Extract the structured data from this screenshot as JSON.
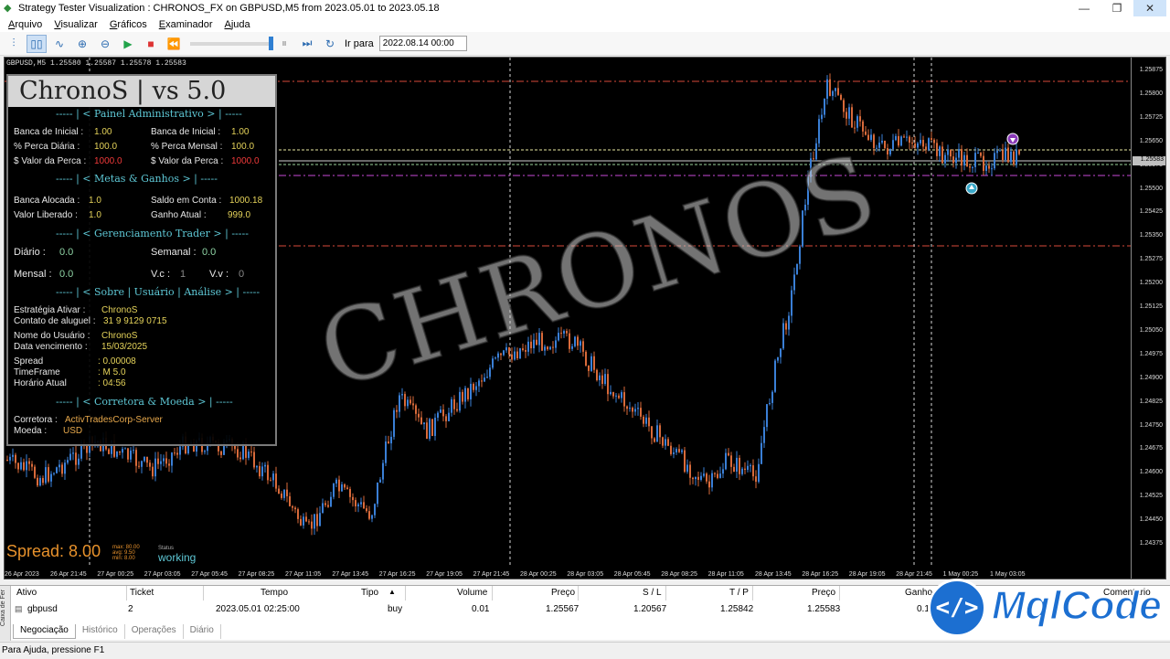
{
  "window": {
    "title": "Strategy Tester Visualization : CHRONOS_FX on GBPUSD,M5 from 2023.05.01 to 2023.05.18",
    "minimize": "—",
    "restore": "❐",
    "close": "✕"
  },
  "menu": [
    "Arquivo",
    "Visualizar",
    "Gráficos",
    "Examinador",
    "Ajuda"
  ],
  "toolbar": {
    "goto_label": "Ir para",
    "goto_date": "2022.08.14 00:00"
  },
  "chart": {
    "symbol_info": "GBPUSD,M5  1.25580 1.25587 1.25578 1.25583",
    "watermark": "CHRONOS",
    "current_price": "1.25583",
    "price_labels": [
      "1.25875",
      "1.25800",
      "1.25725",
      "1.25650",
      "1.25575",
      "1.25500",
      "1.25425",
      "1.25350",
      "1.25275",
      "1.25200",
      "1.25125",
      "1.25050",
      "1.24975",
      "1.24900",
      "1.24825",
      "1.24750",
      "1.24675",
      "1.24600",
      "1.24525",
      "1.24450",
      "1.24375"
    ],
    "time_labels": [
      "26 Apr 2023",
      "26 Apr 21:45",
      "27 Apr 00:25",
      "27 Apr 03:05",
      "27 Apr 05:45",
      "27 Apr 08:25",
      "27 Apr 11:05",
      "27 Apr 13:45",
      "27 Apr 16:25",
      "27 Apr 19:05",
      "27 Apr 21:45",
      "28 Apr 00:25",
      "28 Apr 03:05",
      "28 Apr 05:45",
      "28 Apr 08:25",
      "28 Apr 11:05",
      "28 Apr 13:45",
      "28 Apr 16:25",
      "28 Apr 19:05",
      "28 Apr 21:45",
      "1 May 00:25",
      "1 May 03:05"
    ],
    "spread_label": "Spread: 8.00",
    "spread_max": "max: 80.00",
    "spread_avg": "avg:  9.50",
    "spread_min": "min:  8.00",
    "status_label": "Status",
    "status_value": "working"
  },
  "panel": {
    "title": "ChronoS | vs 5.0",
    "section1": "----- | <   Painel Administrativo   > | -----",
    "banca_inicial_l": "Banca de Inicial  :",
    "banca_inicial_v": "1.00",
    "banca_inicial_r_l": "Banca de Inicial  :",
    "banca_inicial_r_v": "1.00",
    "perca_diaria_l": "% Perca Diária   :",
    "perca_diaria_v": "100.0",
    "perca_mensal_l": "% Perca Mensal  :",
    "perca_mensal_v": "100.0",
    "valor_perca_l": "$ Valor da Perca :",
    "valor_perca_v": "1000.0",
    "valor_perca_r_l": "$ Valor da Perca :",
    "valor_perca_r_v": "1000.0",
    "section2": "----- | <     Metas & Ganhos      > | -----",
    "banca_alocada_l": "Banca Alocada   :",
    "banca_alocada_v": "1.0",
    "saldo_conta_l": "Saldo em Conta  :",
    "saldo_conta_v": "1000.18",
    "valor_liberado_l": "Valor Liberado   :",
    "valor_liberado_v": "1.0",
    "ganho_atual_l": "Ganho Atual       :",
    "ganho_atual_v": "999.0",
    "section3": "----- | < Gerenciamento Trader > | -----",
    "diario_l": "Diário   :",
    "diario_v": "0.0",
    "semanal_l": "Semanal  :",
    "semanal_v": "0.0",
    "mensal_l": "Mensal  :",
    "mensal_v": "0.0",
    "vc_l": "V.c  :",
    "vc_v": "1",
    "vv_l": "V.v  :",
    "vv_v": "0",
    "section4": "----- | < Sobre | Usuário | Análise > | -----",
    "estrategia_l": "Estratégia Ativar    :",
    "estrategia_v": "ChronoS",
    "contato_l": "Contato de aluguel :",
    "contato_v": "31 9 9129 0715",
    "usuario_l": "Nome do Usuário    :",
    "usuario_v": "ChronoS",
    "vencimento_l": "Data vencimento     :",
    "vencimento_v": "15/03/2025",
    "spread_l": "Spread",
    "spread_v": ": 0.00008",
    "timeframe_l": "TimeFrame",
    "timeframe_v": ": M 5.0",
    "horario_l": "Horário Atual",
    "horario_v": ": 04:56",
    "section5": "----- | <    Corretora & Moeda    > | -----",
    "corretora_l": "Corretora  :",
    "corretora_v": "ActivTradesCorp-Server",
    "moeda_l": "Moeda    :",
    "moeda_v": "USD"
  },
  "terminal": {
    "side_label": "Caixa de Fer",
    "headers": {
      "ativo": "Ativo",
      "ticket": "Ticket",
      "tempo": "Tempo",
      "tipo": "Tipo",
      "volume": "Volume",
      "preco": "Preço",
      "sl": "S / L",
      "tp": "T / P",
      "preco2": "Preço",
      "ganho": "Ganho",
      "comentario": "Comentario"
    },
    "row": {
      "ativo": "gbpusd",
      "ticket": "2",
      "tempo": "2023.05.01 02:25:00",
      "tipo": "buy",
      "volume": "0.01",
      "preco": "1.25567",
      "sl": "1.20567",
      "tp": "1.25842",
      "preco2": "1.25583",
      "ganho": "0.1"
    },
    "tabs": [
      "Negociação",
      "Histórico",
      "Operações",
      "Diário"
    ]
  },
  "statusbar": "Para Ajuda, pressione F1",
  "logo": {
    "symbol": "</>",
    "text": "MqlCode"
  }
}
